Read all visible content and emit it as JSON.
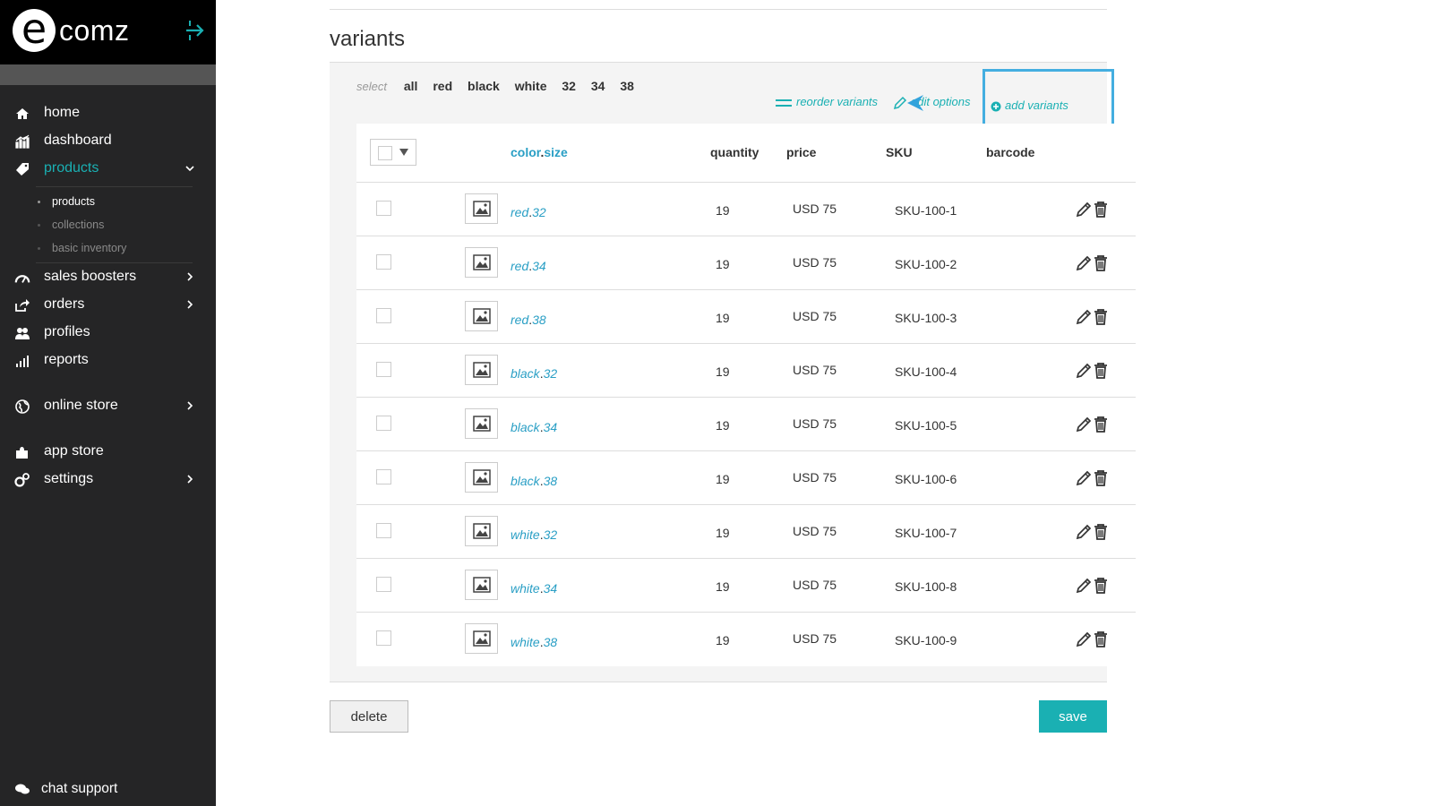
{
  "brand": {
    "logo_letter": "e",
    "logo_text": "comz",
    "accent": "#1ab0b3",
    "link_color": "#2a9fc5"
  },
  "sidebar": {
    "items": [
      {
        "label": "home",
        "icon": "home-icon"
      },
      {
        "label": "dashboard",
        "icon": "dashboard-icon"
      },
      {
        "label": "products",
        "icon": "tag-icon",
        "active": true,
        "expanded": true
      },
      {
        "label": "sales boosters",
        "icon": "speedometer-icon"
      },
      {
        "label": "orders",
        "icon": "share-icon"
      },
      {
        "label": "profiles",
        "icon": "users-icon"
      },
      {
        "label": "reports",
        "icon": "bar-chart-icon"
      },
      {
        "label": "online store",
        "icon": "globe-icon"
      },
      {
        "label": "app store",
        "icon": "puzzle-icon"
      },
      {
        "label": "settings",
        "icon": "gears-icon"
      }
    ],
    "subitems": [
      "products",
      "collections",
      "basic inventory"
    ],
    "chat_support": "chat support"
  },
  "variants": {
    "title": "variants",
    "select_label": "select",
    "select_options": [
      "all",
      "red",
      "black",
      "white",
      "32",
      "34",
      "38"
    ],
    "actions": {
      "reorder": "reorder variants",
      "edit_options": "edit options",
      "add": "add variants"
    },
    "columns": {
      "color": "color",
      "separator": ".",
      "size": "size",
      "quantity": "quantity",
      "price": "price",
      "sku": "SKU",
      "barcode": "barcode"
    },
    "rows": [
      {
        "color": "red",
        "size": "32",
        "qty": "19",
        "price": "USD 75",
        "sku": "SKU-100-1"
      },
      {
        "color": "red",
        "size": "34",
        "qty": "19",
        "price": "USD 75",
        "sku": "SKU-100-2"
      },
      {
        "color": "red",
        "size": "38",
        "qty": "19",
        "price": "USD 75",
        "sku": "SKU-100-3"
      },
      {
        "color": "black",
        "size": "32",
        "qty": "19",
        "price": "USD 75",
        "sku": "SKU-100-4"
      },
      {
        "color": "black",
        "size": "34",
        "qty": "19",
        "price": "USD 75",
        "sku": "SKU-100-5"
      },
      {
        "color": "black",
        "size": "38",
        "qty": "19",
        "price": "USD 75",
        "sku": "SKU-100-6"
      },
      {
        "color": "white",
        "size": "32",
        "qty": "19",
        "price": "USD 75",
        "sku": "SKU-100-7"
      },
      {
        "color": "white",
        "size": "34",
        "qty": "19",
        "price": "USD 75",
        "sku": "SKU-100-8"
      },
      {
        "color": "white",
        "size": "38",
        "qty": "19",
        "price": "USD 75",
        "sku": "SKU-100-9"
      }
    ]
  },
  "buttons": {
    "delete": "delete",
    "save": "save"
  }
}
